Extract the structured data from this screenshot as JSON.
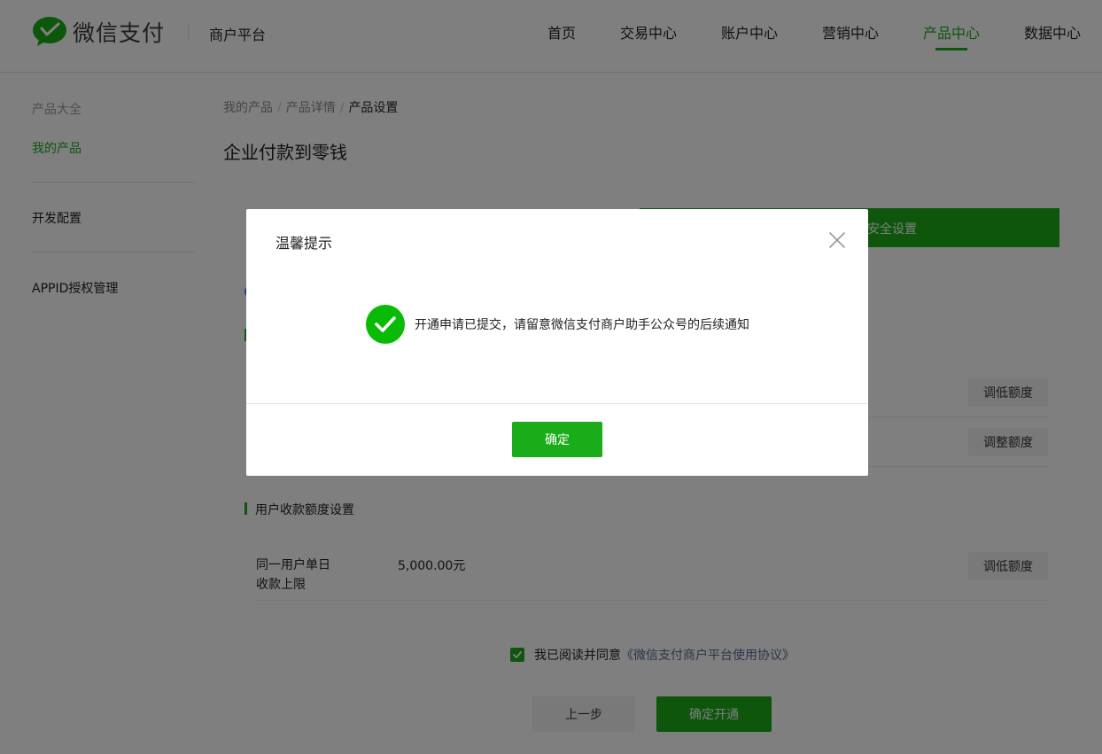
{
  "header": {
    "logo_text": "微信支付",
    "platform": "商户平台",
    "nav": [
      "首页",
      "交易中心",
      "账户中心",
      "营销中心",
      "产品中心",
      "数据中心"
    ],
    "nav_active": "产品中心"
  },
  "sidebar": {
    "group_title": "产品大全",
    "items": [
      "我的产品",
      "开发配置",
      "APPID授权管理"
    ],
    "active": "我的产品"
  },
  "breadcrumb": [
    "我的产品",
    "产品详情",
    "产品设置"
  ],
  "page_title": "企业付款到零钱",
  "card": {
    "tab_label": "安全设置",
    "buttons": {
      "lower_limit_1": "调低额度",
      "adjust_limit": "调整额度",
      "lower_limit_2": "调低额度"
    },
    "user_limit_section": "用户收款额度设置",
    "limit_label_line1": "同一用户单日",
    "limit_label_line2": "收款上限",
    "limit_value": "5,000.00元",
    "agree_text": "我已阅读并同意",
    "agree_link": "《微信支付商户平台使用协议》",
    "prev_button": "上一步",
    "confirm_open_button": "确定开通"
  },
  "dialog": {
    "title": "温馨提示",
    "message": "开通申请已提交，请留意微信支付商户助手公众号的后续通知",
    "ok_button": "确定"
  },
  "colors": {
    "brand_green": "#1aad19",
    "link_blue": "#576b95",
    "success_green": "#09bb07"
  },
  "icons": [
    "wechat-pay-logo-icon",
    "close-icon",
    "success-check-icon",
    "checkbox-check-icon"
  ]
}
